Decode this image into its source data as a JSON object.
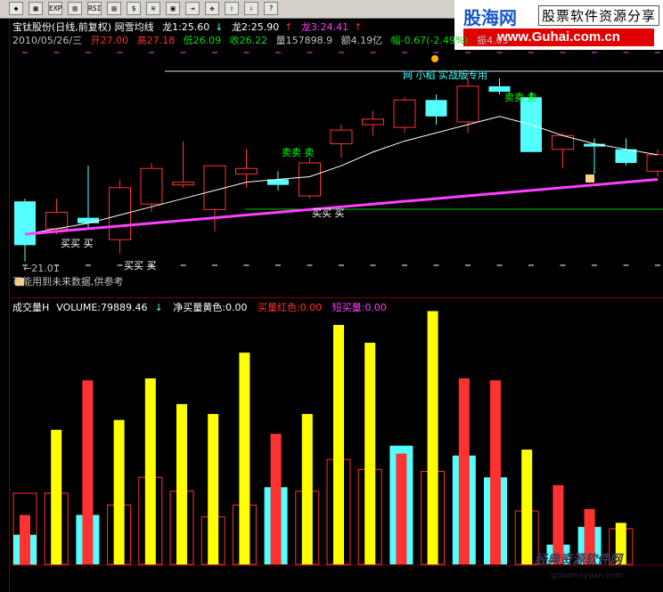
{
  "toolbar": {
    "buttons": [
      "◆",
      "▦",
      "EXP",
      "▥",
      "RSI",
      "▤",
      "$",
      "≋",
      "▣",
      "⇥",
      "✥",
      "⇧",
      "⇩",
      "?"
    ]
  },
  "brand": {
    "name": "股海网",
    "slogan": "股票软件资源分享",
    "url": "www.Guhai.com.cn"
  },
  "header": {
    "title": "宝钛股份(日线,前复权) 网雪均线",
    "long1": "龙1:25.60",
    "long2": "龙2:25.90",
    "long3": "龙3:24.41",
    "date": "2010/05/26/三",
    "open": "开27.00",
    "high": "高27.18",
    "low": "低26.09",
    "close": "收26.22",
    "volume": "量157898.9",
    "amount": "额4.19亿",
    "change": "幅-0.67(-2.49%)",
    "amplitude": "振4.05"
  },
  "main_chart": {
    "type": "candlestick",
    "top_label": "网 小稻 实战版专用",
    "low_marker": "←21.01",
    "warning": "可能用到未来数据,供参考",
    "buy_label": "买买 买",
    "sell_label": "卖卖 卖",
    "candles": [
      {
        "o": 23.2,
        "h": 23.3,
        "l": 21.01,
        "c": 21.6,
        "col": "cyan"
      },
      {
        "o": 22.2,
        "h": 23.3,
        "l": 22.0,
        "c": 22.8,
        "col": "red"
      },
      {
        "o": 22.4,
        "h": 24.5,
        "l": 22.2,
        "c": 22.6,
        "col": "cyan"
      },
      {
        "o": 21.8,
        "h": 24.0,
        "l": 21.3,
        "c": 23.7,
        "col": "red"
      },
      {
        "o": 23.1,
        "h": 24.6,
        "l": 22.8,
        "c": 24.4,
        "col": "red"
      },
      {
        "o": 23.8,
        "h": 25.4,
        "l": 23.7,
        "c": 23.9,
        "col": "red"
      },
      {
        "o": 22.9,
        "h": 24.5,
        "l": 22.1,
        "c": 24.5,
        "col": "red"
      },
      {
        "o": 24.2,
        "h": 25.1,
        "l": 23.7,
        "c": 24.4,
        "col": "red"
      },
      {
        "o": 24.0,
        "h": 24.3,
        "l": 23.6,
        "c": 23.8,
        "col": "cyan"
      },
      {
        "o": 23.4,
        "h": 24.8,
        "l": 23.3,
        "c": 24.6,
        "col": "red"
      },
      {
        "o": 25.3,
        "h": 26.0,
        "l": 24.8,
        "c": 25.8,
        "col": "red"
      },
      {
        "o": 26.0,
        "h": 26.5,
        "l": 25.6,
        "c": 26.2,
        "col": "red"
      },
      {
        "o": 25.9,
        "h": 27.0,
        "l": 25.7,
        "c": 26.9,
        "col": "red"
      },
      {
        "o": 26.9,
        "h": 27.1,
        "l": 26.0,
        "c": 26.3,
        "col": "cyan"
      },
      {
        "o": 26.1,
        "h": 27.9,
        "l": 25.7,
        "c": 27.4,
        "col": "red"
      },
      {
        "o": 27.4,
        "h": 27.7,
        "l": 27.1,
        "c": 27.2,
        "col": "cyan"
      },
      {
        "o": 27.0,
        "h": 27.18,
        "l": 25.0,
        "c": 25.0,
        "col": "cyan"
      },
      {
        "o": 25.1,
        "h": 25.7,
        "l": 24.4,
        "c": 25.6,
        "col": "red"
      },
      {
        "o": 25.3,
        "h": 25.5,
        "l": 24.2,
        "c": 25.2,
        "col": "cyan"
      },
      {
        "o": 25.1,
        "h": 25.5,
        "l": 24.5,
        "c": 24.6,
        "col": "cyan"
      },
      {
        "o": 24.3,
        "h": 25.1,
        "l": 24.1,
        "c": 24.9,
        "col": "red"
      }
    ],
    "ma_white": [
      22.0,
      22.2,
      22.4,
      22.7,
      23.0,
      23.3,
      23.6,
      23.9,
      24.0,
      24.1,
      24.5,
      25.0,
      25.4,
      25.7,
      26.0,
      26.3,
      26.0,
      25.6,
      25.3,
      25.1,
      24.9
    ],
    "ma_magenta": [
      22.0,
      22.1,
      22.2,
      22.3,
      22.4,
      22.5,
      22.6,
      22.7,
      22.8,
      22.9,
      23.0,
      23.1,
      23.2,
      23.3,
      23.4,
      23.5,
      23.6,
      23.7,
      23.8,
      23.9,
      24.0
    ]
  },
  "volume_chart": {
    "name": "成交量H",
    "volume_label": "VOLUME:79889.46",
    "net_yellow": "净买量黄色:0.00",
    "red_label": "买量红色:0.00",
    "short_label": "短买量:0.00",
    "bars": [
      {
        "main": 25000,
        "main_col": "red",
        "hollow": 36000,
        "cyan": 15000
      },
      {
        "main": 68000,
        "main_col": "yellow",
        "hollow": 36000,
        "cyan": 0
      },
      {
        "main": 93000,
        "main_col": "red",
        "hollow": 0,
        "cyan": 25000
      },
      {
        "main": 73000,
        "main_col": "yellow",
        "hollow": 30000,
        "cyan": 0
      },
      {
        "main": 94000,
        "main_col": "yellow",
        "hollow": 44000,
        "cyan": 0
      },
      {
        "main": 81000,
        "main_col": "yellow",
        "hollow": 37000,
        "cyan": 0
      },
      {
        "main": 76000,
        "main_col": "yellow",
        "hollow": 24000,
        "cyan": 0
      },
      {
        "main": 107000,
        "main_col": "yellow",
        "hollow": 30000,
        "cyan": 0
      },
      {
        "main": 66000,
        "main_col": "red",
        "hollow": 0,
        "cyan": 39000
      },
      {
        "main": 76000,
        "main_col": "yellow",
        "hollow": 37000,
        "cyan": 0
      },
      {
        "main": 121000,
        "main_col": "yellow",
        "hollow": 53000,
        "cyan": 0
      },
      {
        "main": 112000,
        "main_col": "yellow",
        "hollow": 48000,
        "cyan": 0
      },
      {
        "main": 56000,
        "main_col": "red",
        "hollow": 0,
        "cyan": 60000
      },
      {
        "main": 128000,
        "main_col": "yellow",
        "hollow": 47000,
        "cyan": 0
      },
      {
        "main": 94000,
        "main_col": "red",
        "hollow": 0,
        "cyan": 55000
      },
      {
        "main": 93000,
        "main_col": "red",
        "hollow": 0,
        "cyan": 44000
      },
      {
        "main": 58000,
        "main_col": "yellow",
        "hollow": 27000,
        "cyan": 0
      },
      {
        "main": 40000,
        "main_col": "red",
        "hollow": 0,
        "cyan": 10000
      },
      {
        "main": 28000,
        "main_col": "red",
        "hollow": 0,
        "cyan": 19000
      },
      {
        "main": 21000,
        "main_col": "yellow",
        "hollow": 18000,
        "cyan": 0
      }
    ]
  },
  "watermark": {
    "text": "经典资源软件网",
    "sub": "goodmeyuan.com"
  }
}
